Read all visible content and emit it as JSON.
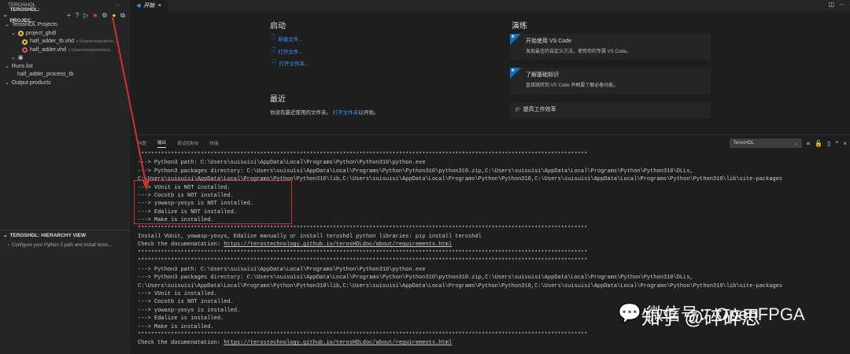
{
  "sidebar": {
    "title": "TEROSHDL",
    "more": "···",
    "section1": "TEROSHDL: PROJEC...",
    "items": [
      {
        "label": "TerosHDL Projects"
      },
      {
        "label": "project_ghdl"
      },
      {
        "label": "half_adder_tb.vhd",
        "desc": "c:\\Users\\suisuisi\\vs..."
      },
      {
        "label": "half_adder.vhd",
        "desc": "c:\\Users\\suisuisi\\vsco..."
      },
      {
        "label": "Runs list"
      },
      {
        "label": "half_adder_process_tb"
      },
      {
        "label": "Output products"
      }
    ],
    "section2": "TEROSHDL: HIERARCHY VIEW",
    "hierarchy_msg": "Configure your Python 3 path and install teros..."
  },
  "editor": {
    "tab": "开始",
    "start": {
      "title": "启动",
      "links": [
        "新建文件...",
        "打开文件...",
        "打开文件夹..."
      ]
    },
    "recent": {
      "title": "最近",
      "text": "你没有最近使用的文件夹。",
      "link": "打开文件夹",
      "suffix": "以开始。"
    },
    "walkthroughs": {
      "title": "演练",
      "cards": [
        {
          "title": "开始使用 VS Code",
          "sub": "发现最佳的自定义方法，使用你的专属 VS Code。"
        },
        {
          "title": "了解基础知识",
          "sub": "直接跳转到 VS Code 并概要了解必备功能。"
        },
        {
          "title": "提高工作效率"
        }
      ]
    }
  },
  "panel": {
    "tabs": [
      "问题",
      "输出",
      "调试控制台",
      "终端"
    ],
    "channel": "TerosHDL",
    "lines": [
      "****************************************************************************************************************************************",
      "---> Python3 path: C:\\Users\\suisuisi\\AppData\\Local\\Programs\\Python\\Python310\\python.exe",
      "---> Python3 packages directory: C:\\Users\\suisuisi\\AppData\\Local\\Programs\\Python\\Python310\\python310.zip,C:\\Users\\suisuisi\\AppData\\Local\\Programs\\Python\\Python310\\DLLs,",
      "C:\\Users\\suisuisi\\AppData\\Local\\Programs\\Python\\Python310\\lib,C:\\Users\\suisuisi\\AppData\\Local\\Programs\\Python\\Python310,C:\\Users\\suisuisi\\AppData\\Local\\Programs\\Python\\Python310\\lib\\site-packages",
      "---> VUnit is NOT installed.",
      "---> Cocotb is NOT installed.",
      "---> yowasp-yosys is NOT installed.",
      "---> Edalize is NOT installed.",
      "---> Make is installed.",
      "****************************************************************************************************************************************",
      "Install VUnit, yowasp-yosys, Edalize manually or install teroshdl python libraries: pip install teroshdl",
      "Check the documenatation: ",
      "****************************************************************************************************************************************",
      "****************************************************************************************************************************************",
      "---> Python3 path: C:\\Users\\suisuisi\\AppData\\Local\\Programs\\Python\\Python310\\python.exe",
      "---> Python3 packages directory: C:\\Users\\suisuisi\\AppData\\Local\\Programs\\Python\\Python310\\python310.zip,C:\\Users\\suisuisi\\AppData\\Local\\Programs\\Python\\Python310\\DLLs,",
      "C:\\Users\\suisuisi\\AppData\\Local\\Programs\\Python\\Python310\\lib,C:\\Users\\suisuisi\\AppData\\Local\\Programs\\Python\\Python310,C:\\Users\\suisuisi\\AppData\\Local\\Programs\\Python\\Python310\\lib\\site-packages",
      "---> VUnit is installed.",
      "---> Cocotb is NOT installed.",
      "---> yowasp-yosys is installed.",
      "---> Edalize is installed.",
      "---> Make is installed.",
      "****************************************************************************************************************************************",
      "Check the documenatation: "
    ],
    "doc_url": "https://terostechnology.github.io/terosHDLdoc/about/requirements.html"
  },
  "watermark": {
    "wechat": "微信号：OpenFPGA",
    "zhihu": "知乎 @碎碎思"
  },
  "colors": {
    "annotation": "#d03030",
    "accent": "#0e70c0"
  }
}
